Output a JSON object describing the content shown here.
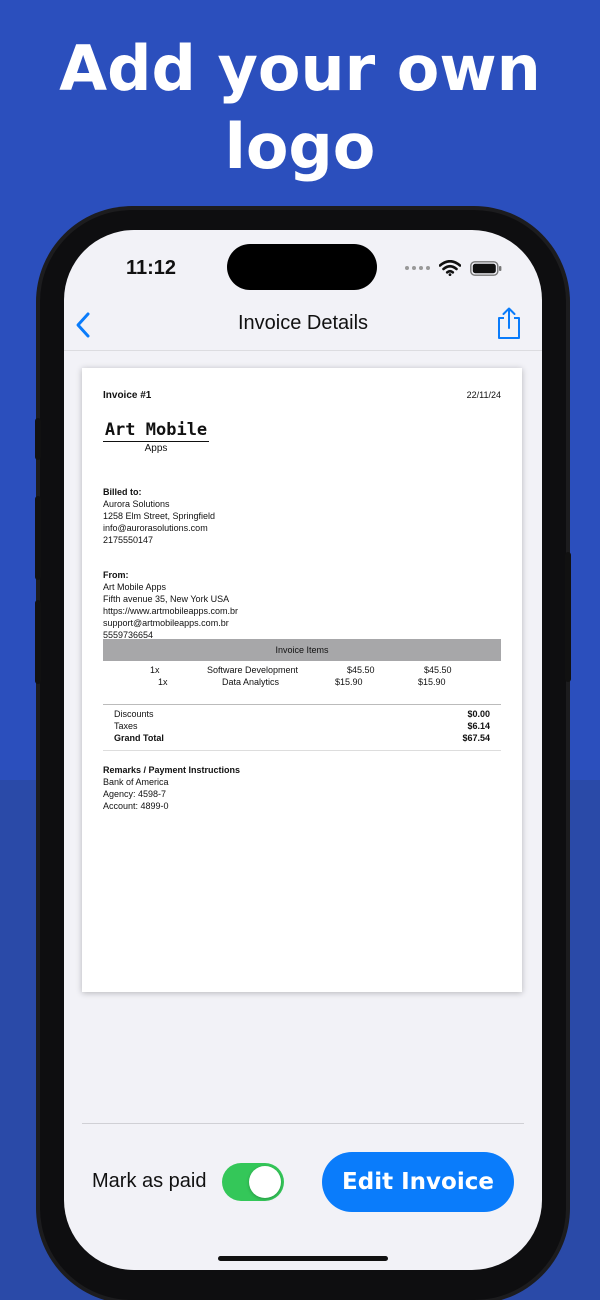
{
  "headline": {
    "line1": "Add your own",
    "line2": "logo"
  },
  "status_bar": {
    "time": "11:12"
  },
  "nav": {
    "title": "Invoice Details",
    "back_icon": "chevron-left",
    "share_icon": "share-up"
  },
  "invoice": {
    "number": "Invoice #1",
    "date": "22/11/24",
    "logo": {
      "main": "Art Mobile",
      "sub": "Apps"
    },
    "billed_to": {
      "label": "Billed to:",
      "name": "Aurora Solutions",
      "address": "1258 Elm Street, Springfield",
      "email": "info@aurorasolutions.com",
      "phone": "2175550147"
    },
    "from": {
      "label": "From:",
      "name": "Art Mobile Apps",
      "address": "Fifth avenue 35, New York USA",
      "website": "https://www.artmobileapps.com.br",
      "email": "support@artmobileapps.com.br",
      "phone": "5559736654"
    },
    "items_header": "Invoice Items",
    "items": [
      {
        "qty": "1x",
        "description": "Software Development",
        "unit_price": "$45.50",
        "total": "$45.50"
      },
      {
        "qty": "1x",
        "description": "Data Analytics",
        "unit_price": "$15.90",
        "total": "$15.90"
      }
    ],
    "totals": {
      "discounts_label": "Discounts",
      "discounts": "$0.00",
      "taxes_label": "Taxes",
      "taxes": "$6.14",
      "grand_total_label": "Grand Total",
      "grand_total": "$67.54"
    },
    "remarks": {
      "label": "Remarks / Payment Instructions",
      "bank": "Bank of America",
      "agency": "Agency: 4598-7",
      "account": "Account: 4899-0"
    }
  },
  "footer": {
    "mark_as_paid_label": "Mark as paid",
    "mark_as_paid_on": true,
    "edit_button": "Edit Invoice"
  },
  "colors": {
    "background": "#2b4fbd",
    "accent": "#0a7cfb",
    "toggle_on": "#34c759"
  }
}
